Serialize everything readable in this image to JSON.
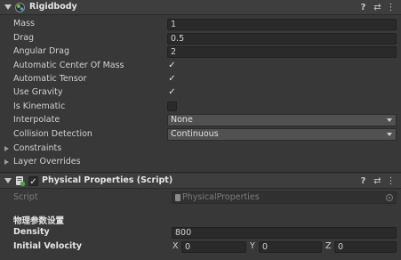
{
  "rigidbody": {
    "title": "Rigidbody",
    "fields": {
      "mass": {
        "label": "Mass",
        "value": "1"
      },
      "drag": {
        "label": "Drag",
        "value": "0.5"
      },
      "angular_drag": {
        "label": "Angular Drag",
        "value": "2"
      },
      "auto_center": {
        "label": "Automatic Center Of Mass",
        "checked": true
      },
      "auto_tensor": {
        "label": "Automatic Tensor",
        "checked": true
      },
      "use_gravity": {
        "label": "Use Gravity",
        "checked": true
      },
      "is_kinematic": {
        "label": "Is Kinematic",
        "checked": false
      },
      "interpolate": {
        "label": "Interpolate",
        "value": "None"
      },
      "collision": {
        "label": "Collision Detection",
        "value": "Continuous"
      }
    },
    "constraints_label": "Constraints",
    "layer_overrides_label": "Layer Overrides"
  },
  "physical_properties": {
    "title": "Physical Properties (Script)",
    "script_label": "Script",
    "script_value": "PhysicalProperties",
    "section_header": "物理参数设置",
    "density": {
      "label": "Density",
      "value": "800"
    },
    "initial_velocity": {
      "label": "Initial Velocity",
      "x_label": "X",
      "x": "0",
      "y_label": "Y",
      "y": "0",
      "z_label": "Z",
      "z": "0"
    }
  },
  "icons": {
    "help": "?",
    "presets": "⇄",
    "menu": "⋮",
    "check": "✓"
  },
  "colors": {
    "background": "#383838",
    "header": "#3e3e3e",
    "field": "#2a2a2a",
    "accent": "#4b7fbf"
  }
}
